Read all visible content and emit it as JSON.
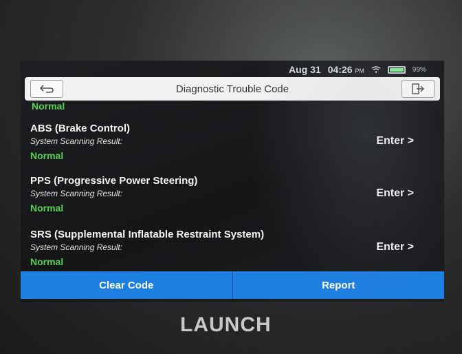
{
  "status": {
    "date": "Aug 31",
    "time": "04:26",
    "ampm": "PM",
    "battery_pct": "99%",
    "battery_level": 0.99
  },
  "header": {
    "title": "Diagnostic Trouble Code"
  },
  "list": {
    "top_status": "Normal",
    "items": [
      {
        "name": "ABS (Brake Control)",
        "label": "System Scanning Result:",
        "status": "Normal",
        "action": "Enter >"
      },
      {
        "name": "PPS (Progressive Power Steering)",
        "label": "System Scanning Result:",
        "status": "Normal",
        "action": "Enter >"
      },
      {
        "name": "SRS (Supplemental Inflatable Restraint System)",
        "label": "System Scanning Result:",
        "status": "Normal",
        "action": "Enter >"
      }
    ]
  },
  "footer": {
    "clear_label": "Clear Code",
    "report_label": "Report"
  },
  "device": {
    "brand": "LAUNCH"
  },
  "colors": {
    "accent": "#1d7fe0",
    "normal": "#54d154"
  },
  "icons": {
    "back": "back-arrow-icon",
    "exit": "exit-icon",
    "wifi": "wifi-icon",
    "battery": "battery-icon"
  }
}
